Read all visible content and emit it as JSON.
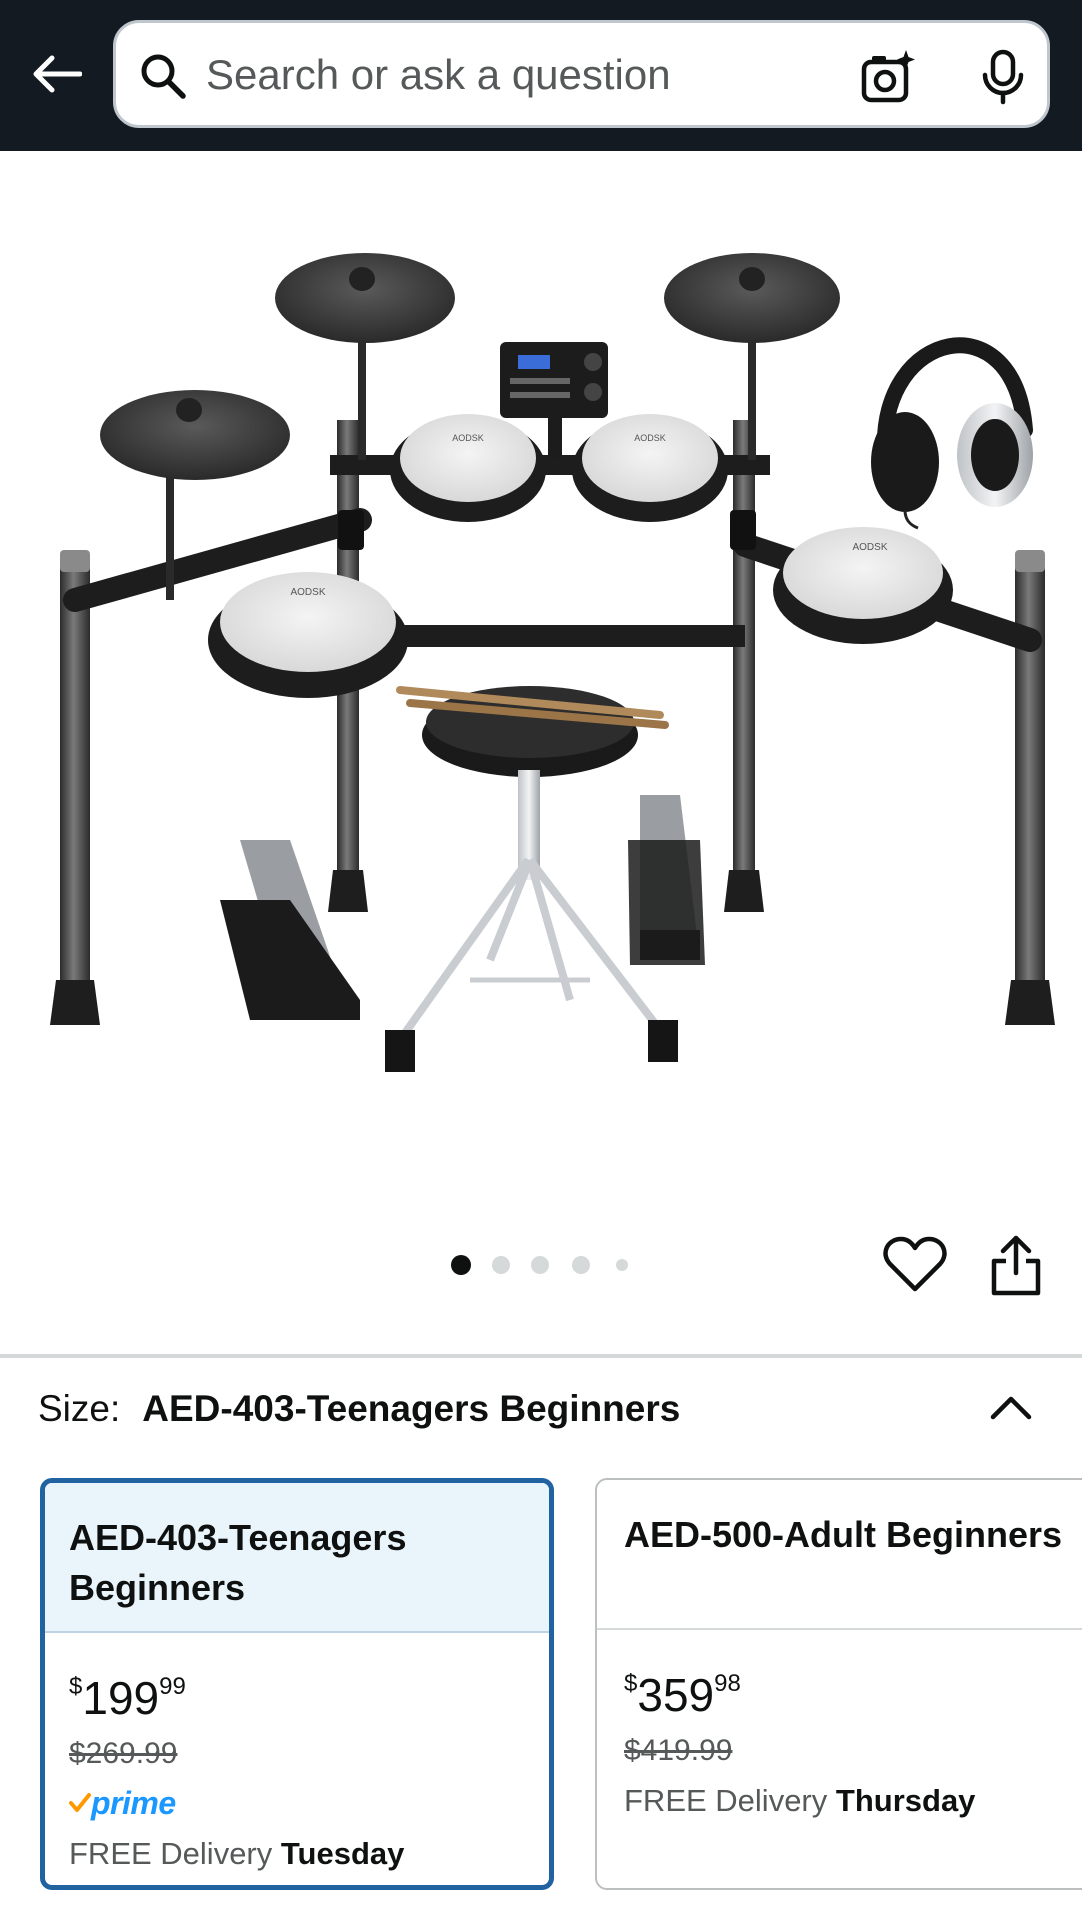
{
  "search": {
    "placeholder": "Search or ask a question"
  },
  "product": {
    "image_pagination": {
      "total": 5,
      "active_index": 0
    },
    "image_brand_text": "AODSK"
  },
  "size_selector": {
    "label": "Size:",
    "selected_value": "AED-403-Teenagers Beginners",
    "options": [
      {
        "title": "AED-403-Teenagers Beginners",
        "price_currency": "$",
        "price_whole": "199",
        "price_fraction": "99",
        "list_price": "$269.99",
        "prime_label": "prime",
        "delivery_prefix": "FREE Delivery",
        "delivery_day": "Tuesday",
        "selected": true
      },
      {
        "title": "AED-500-Adult Beginners",
        "price_currency": "$",
        "price_whole": "359",
        "price_fraction": "98",
        "list_price": "$419.99",
        "delivery_prefix": "FREE Delivery",
        "delivery_day": "Thursday",
        "selected": false
      }
    ]
  },
  "colors": {
    "header_bg": "#131a22",
    "selected_border": "#2162a1",
    "prime_blue": "#1a98ff",
    "prime_check": "#ff9900"
  },
  "icons": {
    "back": "arrow-left-icon",
    "search": "search-icon",
    "camera": "camera-sparkle-icon",
    "mic": "microphone-icon",
    "wishlist": "heart-icon",
    "share": "share-icon",
    "collapse": "chevron-up-icon"
  }
}
